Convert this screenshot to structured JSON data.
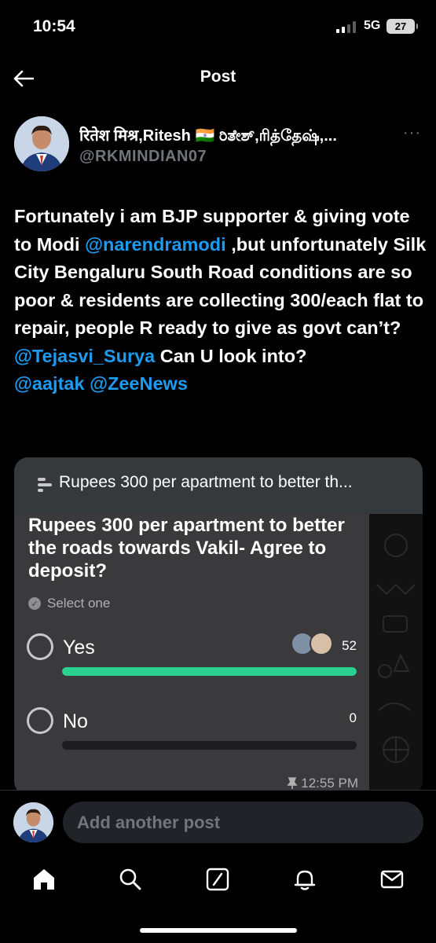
{
  "status_bar": {
    "time": "10:54",
    "network": "5G",
    "battery": "27"
  },
  "header": {
    "title": "Post"
  },
  "author": {
    "display_name": "रितेश मिश्र,Ritesh 🇮🇳 ರಿತೇಶ್,ரித்தேஷ்,...",
    "handle": "@RKMINDIAN07"
  },
  "post": {
    "text_1": "Fortunately i am BJP supporter & giving vote to Modi ",
    "mention_1": "@narendramodi",
    "text_2": " ,but unfortunately Silk City Bengaluru South Road conditions are so poor & residents are collecting 300/each flat to repair, people R ready to give as govt can’t? ",
    "mention_2": "@Tejasvi_Surya",
    "text_3": " Can U look into? ",
    "mention_3": "@aajtak",
    "mention_4": "@ZeeNews"
  },
  "poll_card": {
    "header_text": "Rupees 300 per apartment to better th...",
    "question": "Rupees 300 per apartment to better the roads towards Vakil- Agree to deposit?",
    "hint": "Select one",
    "options": [
      {
        "label": "Yes",
        "count": "52",
        "fraction": 1.0
      },
      {
        "label": "No",
        "count": "0",
        "fraction": 0.0
      }
    ],
    "time": "12:55 PM"
  },
  "reply": {
    "placeholder": "Add another post"
  },
  "colors": {
    "accent": "#1d9bf0",
    "poll_bar": "#2bd18f",
    "background": "#000000"
  },
  "tabs": [
    "home-icon",
    "search-icon",
    "grok-icon",
    "notifications-icon",
    "messages-icon"
  ]
}
